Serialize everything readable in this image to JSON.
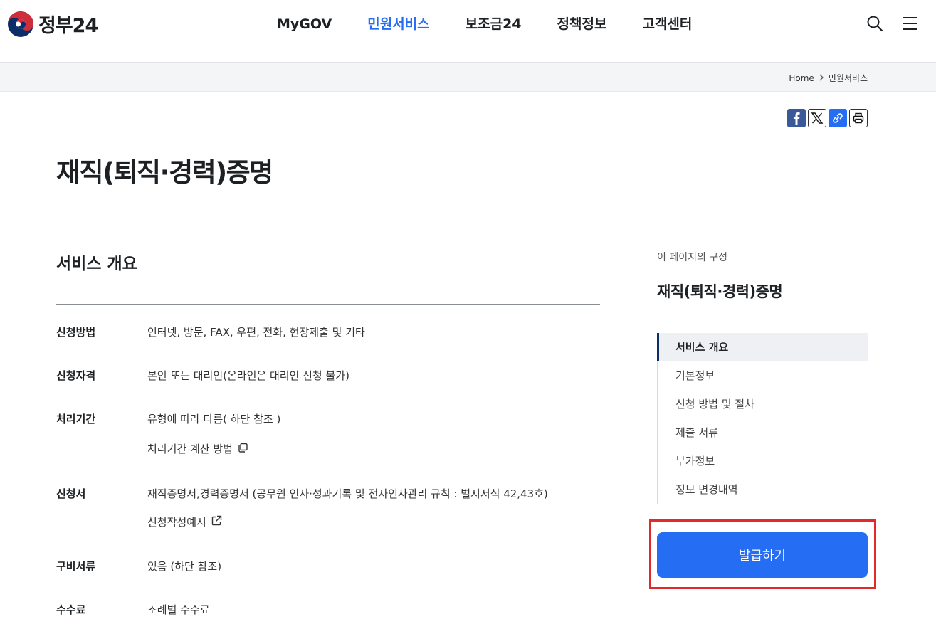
{
  "header": {
    "logo_text": "정부24",
    "nav": [
      {
        "label": "MyGOV",
        "active": false
      },
      {
        "label": "민원서비스",
        "active": true
      },
      {
        "label": "보조금24",
        "active": false
      },
      {
        "label": "정책정보",
        "active": false
      },
      {
        "label": "고객센터",
        "active": false
      }
    ],
    "icons": [
      "search-icon",
      "menu-icon"
    ]
  },
  "breadcrumb": {
    "home": "Home",
    "current": "민원서비스"
  },
  "share": {
    "icons": [
      "facebook-icon",
      "x-icon",
      "link-icon",
      "print-icon"
    ]
  },
  "page": {
    "title": "재직(퇴직·경력)증명"
  },
  "overview": {
    "title": "서비스 개요",
    "rows": [
      {
        "label": "신청방법",
        "value": "인터넷, 방문, FAX, 우편, 전화, 현장제출 및 기타"
      },
      {
        "label": "신청자격",
        "value": "본인 또는 대리인(온라인은 대리인 신청 불가)"
      },
      {
        "label": "처리기간",
        "value": "유형에 따라 다름( 하단 참조 )",
        "link": "처리기간 계산 방법"
      },
      {
        "label": "신청서",
        "value": "재직증명서,경력증명서 (공무원 인사·성과기록 및 전자인사관리 규칙 : 별지서식 42,43호)",
        "link": "신청작성예시"
      },
      {
        "label": "구비서류",
        "value": "있음 (하단 참조)"
      },
      {
        "label": "수수료",
        "value": "조례별 수수료"
      }
    ]
  },
  "aside": {
    "caption": "이 페이지의 구성",
    "title": "재직(퇴직·경력)증명",
    "toc": [
      {
        "label": "서비스 개요",
        "active": true
      },
      {
        "label": "기본정보",
        "active": false
      },
      {
        "label": "신청 방법 및 절차",
        "active": false
      },
      {
        "label": "제출 서류",
        "active": false
      },
      {
        "label": "부가정보",
        "active": false
      },
      {
        "label": "정보 변경내역",
        "active": false
      }
    ],
    "apply_label": "발급하기"
  },
  "colors": {
    "accent": "#256ef4",
    "highlight": "#e32a2a",
    "toc_active_bar": "#0b2e6b"
  }
}
